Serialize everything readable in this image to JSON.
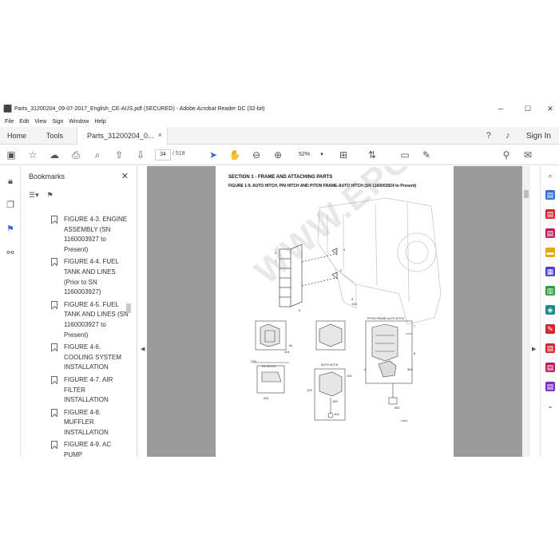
{
  "window": {
    "title": "Parts_31200204_09-07-2017_English_CE-AUS.pdf (SECURED) - Adobe Acrobat Reader DC (32-bit)",
    "minimize": "─",
    "maximize": "☐",
    "close": "✕"
  },
  "menu": [
    "File",
    "Edit",
    "View",
    "Sign",
    "Window",
    "Help"
  ],
  "tabs": {
    "home": "Home",
    "tools": "Tools",
    "document": "Parts_31200204_0...",
    "close": "×",
    "sign_in": "Sign In"
  },
  "toolbar": {
    "page_current": "34",
    "page_total": "/ 518",
    "zoom": "52%"
  },
  "bookmarks": {
    "header": "Bookmarks",
    "close": "✕",
    "items": [
      "FIGURE 4-3. ENGINE ASSEMBLY (SN 1160003927 to Present)",
      "FIGURE 4-4. FUEL TANK AND LINES (Prior to SN 1160003927)",
      "FIGURE 4-5. FUEL TANK AND LINES (SN 1160003927 to Present)",
      "FIGURE 4-6. COOLING SYSTEM INSTALLATION",
      "FIGURE 4-7. AIR FILTER INSTALLATION",
      "FIGURE 4-8. MUFFLER INSTALLATION",
      "FIGURE 4-9. AC PUMP"
    ]
  },
  "document": {
    "section": "SECTION 1 - FRAME AND ATTACHING PARTS",
    "figure": "FIGURE 1-9. AUTO HITCH, PIN HITCH AND PITON FRAME-AUTO HITCH (SN 1160003924 to Present)",
    "labels": {
      "pin_hitch": "PIN HITCH",
      "auto_hitch": "AUTO HITCH",
      "piton": "PITON FRAME-AUTO HITCH",
      "code": "F0581"
    },
    "numbers": [
      "2",
      "3",
      "4",
      "5",
      "6",
      "7",
      "8",
      "1",
      "101",
      "102",
      "103",
      "100",
      "201",
      "301",
      "302",
      "104"
    ],
    "watermark": "WWW.EPCATALOGS.COM"
  },
  "colors": {
    "accent_blue": "#2f6fd6",
    "acrobat_red": "#d6262d",
    "page_background": "#9b9b9b"
  }
}
